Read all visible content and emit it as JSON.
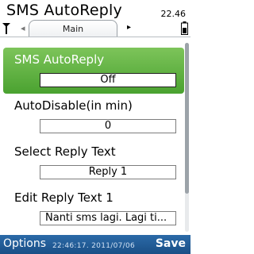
{
  "app_title": "SMS AutoReply",
  "status": {
    "time": "22.46",
    "signal_icon": "signal-strength-icon",
    "battery_icon": "battery-icon"
  },
  "tabs": [
    {
      "label": "Main",
      "selected": true
    }
  ],
  "tab_nav": {
    "right_arrow": "▸"
  },
  "items": [
    {
      "label": "SMS AutoReply",
      "value": "Off",
      "highlighted": true
    },
    {
      "label": "AutoDisable(in min)",
      "value": "0"
    },
    {
      "label": "Select Reply Text",
      "value": "Reply 1"
    },
    {
      "label": "Edit Reply Text 1",
      "value": "Nanti sms lagi. Lagi ti..."
    }
  ],
  "softkeys": {
    "left": "Options",
    "right": "Save",
    "center": "22:46:17. 2011/07/06"
  },
  "colors": {
    "highlight": "#5cb23a",
    "softkey_bar": "#1f5a94",
    "text": "#000000"
  }
}
